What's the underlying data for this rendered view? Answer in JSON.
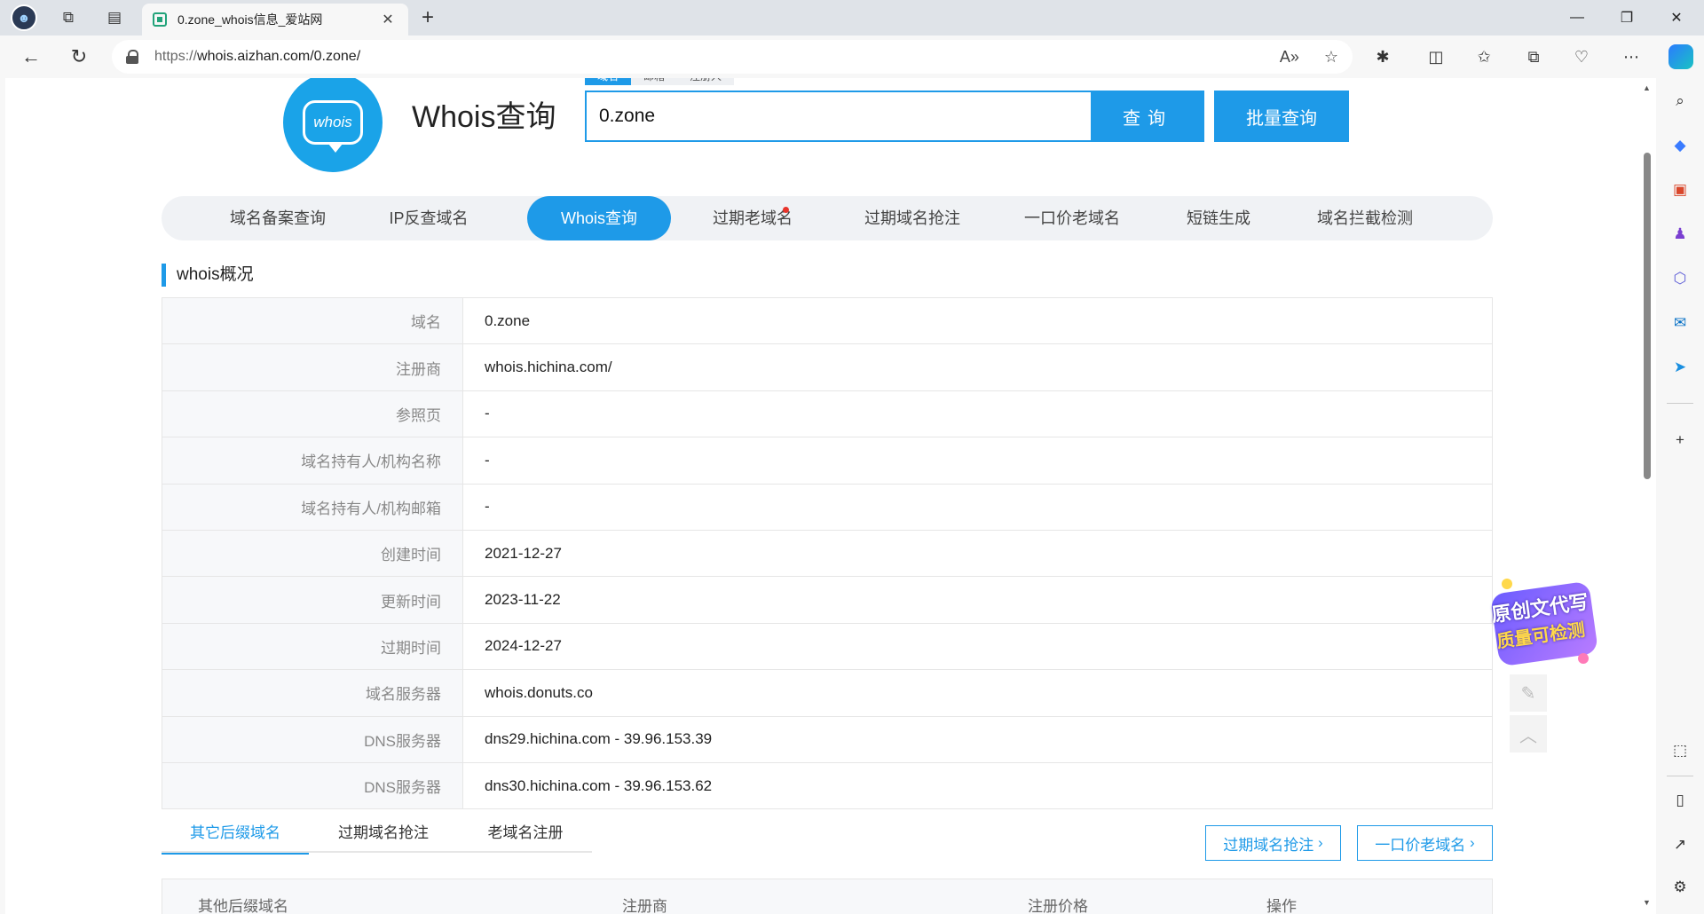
{
  "browser": {
    "tab_title": "0.zone_whois信息_爱站网",
    "url_scheme": "https://",
    "url_rest": "whois.aizhan.com/0.zone/"
  },
  "header": {
    "logo_text": "whois",
    "site_title": "Whois查询",
    "search_tabs": [
      "域名",
      "邮箱",
      "注册人"
    ],
    "search_value": "0.zone",
    "query_button": "查询",
    "batch_button": "批量查询"
  },
  "nav": {
    "items": [
      "域名备案查询",
      "IP反查域名",
      "Whois查询",
      "过期老域名",
      "过期域名抢注",
      "一口价老域名",
      "短链生成",
      "域名拦截检测"
    ],
    "active_index": 2
  },
  "section_title": "whois概况",
  "whois": [
    {
      "key": "域名",
      "value": "0.zone"
    },
    {
      "key": "注册商",
      "value": "whois.hichina.com/"
    },
    {
      "key": "参照页",
      "value": "-"
    },
    {
      "key": "域名持有人/机构名称",
      "value": "-"
    },
    {
      "key": "域名持有人/机构邮箱",
      "value": "-"
    },
    {
      "key": "创建时间",
      "value": "2021-12-27"
    },
    {
      "key": "更新时间",
      "value": "2023-11-22"
    },
    {
      "key": "过期时间",
      "value": "2024-12-27"
    },
    {
      "key": "域名服务器",
      "value": "whois.donuts.co"
    },
    {
      "key": "DNS服务器",
      "value": "dns29.hichina.com - 39.96.153.39"
    },
    {
      "key": "DNS服务器",
      "value": "dns30.hichina.com - 39.96.153.62"
    }
  ],
  "bottom_tabs": [
    "其它后缀域名",
    "过期域名抢注",
    "老域名注册"
  ],
  "bottom_buttons": [
    "过期域名抢注",
    "一口价老域名"
  ],
  "sub_table_headers": [
    "其他后缀域名",
    "注册商",
    "注册价格",
    "操作"
  ],
  "promo": {
    "line1": "原创文代写",
    "line2": "质量可检测"
  },
  "colors": {
    "accent": "#1e9ae8",
    "nav_bg": "#f0f2f5",
    "badge_red": "#e8342b"
  }
}
